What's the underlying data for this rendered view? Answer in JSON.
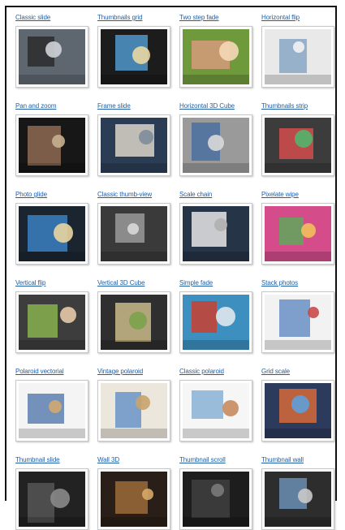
{
  "gallery": {
    "items": [
      {
        "label": "Classic slide",
        "icon": "photo-thumbnail-icon",
        "bg": "#5e6770",
        "accent": "#2b2b2b",
        "hi": "#cfd3d8"
      },
      {
        "label": "Thumbnails grid",
        "icon": "photo-thumbnail-icon",
        "bg": "#1c1c1c",
        "accent": "#4f97c9",
        "hi": "#e8d7a3"
      },
      {
        "label": "Two step fade",
        "icon": "photo-thumbnail-icon",
        "bg": "#6f9a3c",
        "accent": "#d79b7a",
        "hi": "#f4d8b8"
      },
      {
        "label": "Horizontal flip",
        "icon": "photo-thumbnail-icon",
        "bg": "#e9e9e9",
        "accent": "#8aa7c6",
        "hi": "#f2f2f2"
      },
      {
        "label": "Pan and zoom",
        "icon": "photo-thumbnail-icon",
        "bg": "#171717",
        "accent": "#8e6a52",
        "hi": "#c7b08e"
      },
      {
        "label": "Frame slide",
        "icon": "photo-thumbnail-icon",
        "bg": "#2b3d55",
        "accent": "#d9d4c8",
        "hi": "#7f8c9b"
      },
      {
        "label": "Horizontal 3D Cube",
        "icon": "photo-thumbnail-icon",
        "bg": "#9a9a9a",
        "accent": "#4a6fa0",
        "hi": "#d9d9d9"
      },
      {
        "label": "Thumbnails strip",
        "icon": "photo-thumbnail-icon",
        "bg": "#3c3c3c",
        "accent": "#d24c4c",
        "hi": "#52b56b"
      },
      {
        "label": "Photo glide",
        "icon": "photo-thumbnail-icon",
        "bg": "#1b2530",
        "accent": "#3a7fc1",
        "hi": "#e9d6a0"
      },
      {
        "label": "Classic thumb-view",
        "icon": "photo-thumbnail-icon",
        "bg": "#3a3a3a",
        "accent": "#9a9a9a",
        "hi": "#d8d8d8"
      },
      {
        "label": "Scale chain",
        "icon": "photo-thumbnail-icon",
        "bg": "#253446",
        "accent": "#e6e6e6",
        "hi": "#b0b0b0"
      },
      {
        "label": "Pixelate wipe",
        "icon": "photo-thumbnail-icon",
        "bg": "#d44c8a",
        "accent": "#5fa85a",
        "hi": "#f1c05b"
      },
      {
        "label": "Vertical flip",
        "icon": "photo-thumbnail-icon",
        "bg": "#3d3d3d",
        "accent": "#86b04c",
        "hi": "#e4c9a8"
      },
      {
        "label": "Vertical 3D Cube",
        "icon": "photo-thumbnail-icon",
        "bg": "#2f2f2f",
        "accent": "#c9b888",
        "hi": "#7aa24c"
      },
      {
        "label": "Simple fade",
        "icon": "photo-thumbnail-icon",
        "bg": "#3d8fbf",
        "accent": "#c9402f",
        "hi": "#dfe8ee"
      },
      {
        "label": "Stack photos",
        "icon": "photo-thumbnail-icon",
        "bg": "#f2f2f2",
        "accent": "#6a8fc4",
        "hi": "#c94a4a"
      },
      {
        "label": "Polaroid vectorial",
        "icon": "photo-thumbnail-icon",
        "bg": "#f4f4f4",
        "accent": "#5c7fb0",
        "hi": "#d0a870"
      },
      {
        "label": "Vintage polaroid",
        "icon": "photo-thumbnail-icon",
        "bg": "#ece7dc",
        "accent": "#6b94c8",
        "hi": "#c9a36b"
      },
      {
        "label": "Classic polaroid",
        "icon": "photo-thumbnail-icon",
        "bg": "#f6f6f6",
        "accent": "#88b2d6",
        "hi": "#c98b5f"
      },
      {
        "label": "Grid scale",
        "icon": "photo-thumbnail-icon",
        "bg": "#2c3a5c",
        "accent": "#d66a3a",
        "hi": "#5fa0d9"
      },
      {
        "label": "Thumbnail slide",
        "icon": "photo-thumbnail-icon",
        "bg": "#222222",
        "accent": "#555555",
        "hi": "#8a8a8a"
      },
      {
        "label": "Wall 3D",
        "icon": "photo-thumbnail-icon",
        "bg": "#2a1f18",
        "accent": "#9b6b3a",
        "hi": "#d7a868"
      },
      {
        "label": "Thumbnail scroll",
        "icon": "photo-thumbnail-icon",
        "bg": "#1d1d1d",
        "accent": "#3f3f3f",
        "hi": "#7a7a7a"
      },
      {
        "label": "Thumbnail wall",
        "icon": "photo-thumbnail-icon",
        "bg": "#2d2d2d",
        "accent": "#6b8fb5",
        "hi": "#c9c9c9"
      }
    ]
  }
}
